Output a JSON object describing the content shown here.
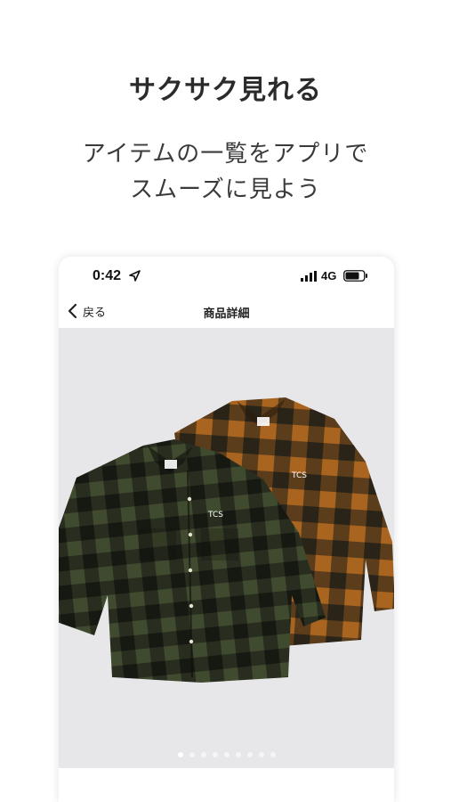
{
  "promo": {
    "headline": "サクサク見れる",
    "subline1": "アイテムの一覧をアプリで",
    "subline2": "スムーズに見よう"
  },
  "status_bar": {
    "time": "0:42",
    "network": "4G",
    "icons": [
      "location-arrow-icon",
      "signal-icon",
      "battery-icon"
    ]
  },
  "nav": {
    "back_label": "戻る",
    "title": "商品詳細"
  },
  "product_image": {
    "logo_text_front": "TCS",
    "logo_text_back": "TCS",
    "page_count": 9,
    "active_page": 1
  },
  "colors": {
    "gallery_bg": "#e7e7ea",
    "shirt_green": "#3f4a2e",
    "shirt_brown": "#a9651f",
    "check_dark": "#1c1b17"
  }
}
